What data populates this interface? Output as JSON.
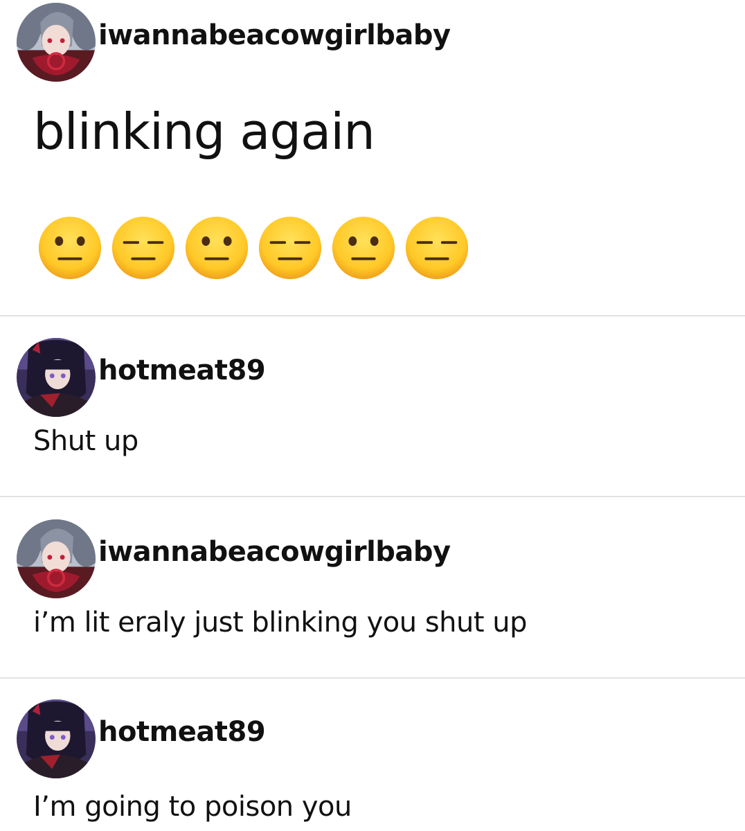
{
  "posts": [
    {
      "username": "iwannabeacowgirlbaby",
      "text": "blinking again",
      "avatar": "avatar-silver-hair"
    },
    {
      "username": "hotmeat89",
      "text": "Shut up",
      "avatar": "avatar-dark-hair"
    },
    {
      "username": "iwannabeacowgirlbaby",
      "text": "i’m lit eraly just blinking you shut up",
      "avatar": "avatar-silver-hair"
    },
    {
      "username": "hotmeat89",
      "text": "I’m going to poison you",
      "avatar": "avatar-dark-hair"
    }
  ],
  "emojis": [
    "neutral-face-icon",
    "expressionless-face-icon",
    "neutral-face-icon",
    "expressionless-face-icon",
    "neutral-face-icon",
    "expressionless-face-icon"
  ],
  "colors": {
    "emoji_fill": "#ffcc33",
    "emoji_edge": "#f0a81f",
    "divider": "#e2e2e2"
  }
}
